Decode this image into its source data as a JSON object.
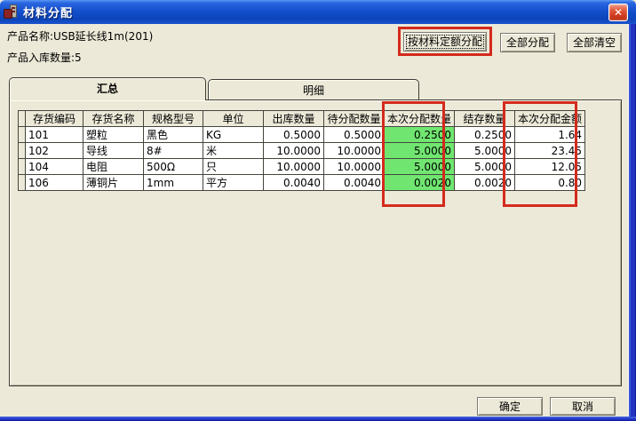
{
  "window": {
    "title": "材料分配",
    "close_glyph": "✕"
  },
  "header": {
    "product_name": "产品名称:USB延长线1m(201)",
    "product_inbound_qty": "产品入库数量:5",
    "buttons": {
      "allocate_by_quota": "按材料定额分配",
      "allocate_all": "全部分配",
      "clear_all": "全部清空"
    }
  },
  "tabs": {
    "summary": "汇总",
    "detail": "明细",
    "active": "汇总"
  },
  "table": {
    "columns": [
      "存货编码",
      "存货名称",
      "规格型号",
      "单位",
      "出库数量",
      "待分配数量",
      "本次分配数量",
      "结存数量",
      "本次分配金额"
    ],
    "highlighted_column": "本次分配数量",
    "rows": [
      [
        "101",
        "塑粒",
        "黑色",
        "KG",
        "0.5000",
        "0.5000",
        "0.2500",
        "0.2500",
        "1.64"
      ],
      [
        "102",
        "导线",
        "8#",
        "米",
        "10.0000",
        "10.0000",
        "5.0000",
        "5.0000",
        "23.45"
      ],
      [
        "104",
        "电阻",
        "500Ω",
        "只",
        "10.0000",
        "10.0000",
        "5.0000",
        "5.0000",
        "12.05"
      ],
      [
        "106",
        "薄铜片",
        "1mm",
        "平方",
        "0.0040",
        "0.0040",
        "0.0020",
        "0.0020",
        "0.80"
      ]
    ]
  },
  "footer": {
    "ok": "确定",
    "cancel": "取消"
  },
  "colors": {
    "dialog_bg": "#ece9d8",
    "highlight_green": "#70e670",
    "annotation_red": "#d42a1d",
    "titlebar_blue": "#1450cd",
    "frame_blue": "#2233c0"
  }
}
